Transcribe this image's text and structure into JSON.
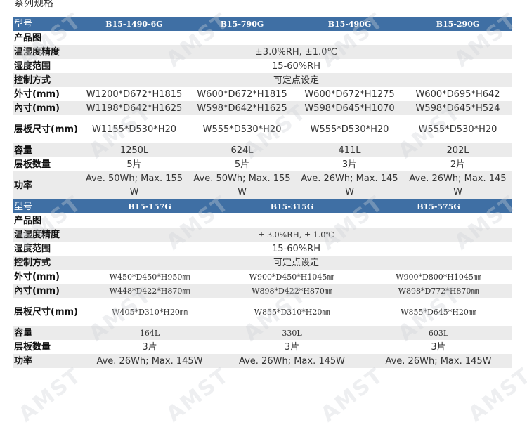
{
  "title": "系列规格",
  "watermark": "AMST",
  "table1": {
    "header_label": "型号",
    "models": [
      "B15-1490-6G",
      "B15-790G",
      "B15-490G",
      "B15-290G"
    ],
    "rows": {
      "image_label": "产品图",
      "accuracy_label": "温湿度精度",
      "accuracy_value": "±3.0%RH, ±1.0℃",
      "humidity_label": "湿度范围",
      "humidity_value": "15-60%RH",
      "control_label": "控制方式",
      "control_value": "可定点设定",
      "outer_label": "外寸(mm)",
      "outer": [
        "W1200*D672*H1815",
        "W600*D672*H1815",
        "W600*D672*H1275",
        "W600*D695*H642"
      ],
      "inner_label": "內寸(mm)",
      "inner": [
        "W1198*D642*H1625",
        "W598*D642*H1625",
        "W598*D645*H1070",
        "W598*D645*H524"
      ],
      "shelf_size_label": "层板尺寸(mm)",
      "shelf_size": [
        "W1155*D530*H20",
        "W555*D530*H20",
        "W555*D530*H20",
        "W555*D530*H20"
      ],
      "capacity_label": "容量",
      "capacity": [
        "1250L",
        "624L",
        "411L",
        "202L"
      ],
      "shelves_label": "层板数量",
      "shelves": [
        "5片",
        "5片",
        "3片",
        "2片"
      ],
      "power_label": "功率",
      "power": [
        "Ave. 50Wh; Max. 155 W",
        "Ave. 50Wh; Max. 155 W",
        "Ave. 26Wh; Max. 145 W",
        "Ave. 26Wh; Max. 145 W"
      ]
    }
  },
  "table2": {
    "header_label": "型号",
    "models": [
      "B15-157G",
      "B15-315G",
      "B15-575G"
    ],
    "rows": {
      "image_label": "产品图",
      "accuracy_label": "温湿度精度",
      "accuracy_value": "± 3.0%RH, ± 1.0℃",
      "humidity_label": "湿度范围",
      "humidity_value": "15-60%RH",
      "control_label": "控制方式",
      "control_value": "可定点设定",
      "outer_label": "外寸(mm)",
      "outer": [
        "W450*D450*H950㎜",
        "W900*D450*H1045㎜",
        "W900*D800*H1045㎜"
      ],
      "inner_label": "內寸(mm)",
      "inner": [
        "W448*D422*H870㎜",
        "W898*D422*H870㎜",
        "W898*D772*H870㎜"
      ],
      "shelf_size_label": "层板尺寸(mm)",
      "shelf_size": [
        "W405*D310*H20㎜",
        "W855*D310*H20㎜",
        "W855*D645*H20㎜"
      ],
      "capacity_label": "容量",
      "capacity": [
        "164L",
        "330L",
        "603L"
      ],
      "shelves_label": "层板数量",
      "shelves": [
        "3片",
        "3片",
        "3片"
      ],
      "power_label": "功率",
      "power": [
        "Ave. 26Wh; Max. 145W",
        "Ave. 26Wh; Max. 145W",
        "Ave. 26Wh; Max. 145W"
      ]
    }
  }
}
